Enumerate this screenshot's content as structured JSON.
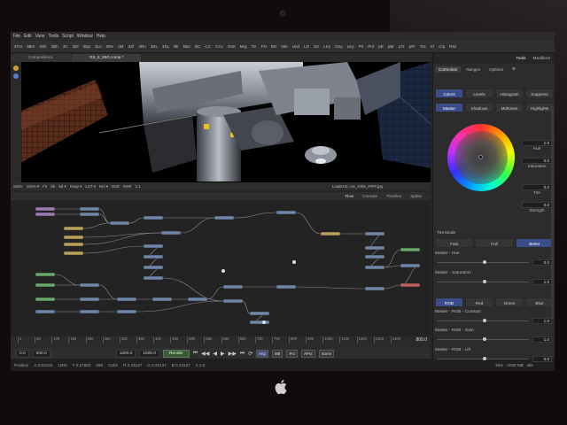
{
  "menus": [
    "File",
    "Edit",
    "View",
    "Tools",
    "Script",
    "Window",
    "Help"
  ],
  "toolbar_tools": [
    "3Txt",
    "3Bm",
    "3Sh",
    "3Bh",
    "3C",
    "3Dl",
    "3Dp",
    "3Lo",
    "3Re",
    "3M",
    "3Xf",
    "3Rn",
    "3SL",
    "3SL",
    "Blr",
    "Blur",
    "BC",
    "CC",
    "CCv",
    "Gmt",
    "Mrg",
    "Tcr",
    "FN",
    "BG",
    "Nte",
    "Und",
    "LD",
    "SV",
    "LKy",
    "CKy",
    "LKy",
    "Pri",
    "Pnt",
    "pE",
    "pBr",
    "pTr",
    "pPr",
    "Tra",
    "Xf",
    "Crp",
    "Rsz"
  ],
  "tabs": [
    "Composition1",
    "RS_5_95G.comp *"
  ],
  "viewer_bar": [
    "SubV",
    "116% ▾",
    "Fit",
    "Sb",
    "6d ▾",
    "Snap ▾",
    "LUT ▾",
    "Roi ▾",
    "DoD",
    "SmR",
    "1:1"
  ],
  "loader_label": "Loader11: iss_v006_####.jpg",
  "flow_tabs": [
    "Flow",
    "Console",
    "Timeline",
    "Spline"
  ],
  "ruler_ticks": [
    "0",
    "50",
    "100",
    "150",
    "200",
    "250",
    "300",
    "350",
    "400",
    "450",
    "500",
    "550",
    "600",
    "650",
    "700",
    "750",
    "800",
    "900",
    "1000",
    "1100",
    "1200",
    "1300",
    "1400"
  ],
  "time_end": "800.0",
  "transport": {
    "start": "0.0",
    "range_start": "800.0",
    "mid_a": "1200.0",
    "mid_b": "1500.0",
    "render": "Render",
    "buttons": [
      "HiQ",
      "MB",
      "Prx",
      "APrx",
      "Some"
    ]
  },
  "status": {
    "position_label": "Position",
    "x": "X 0.52102",
    "frame": "1000",
    "y": "Y 0.27583",
    "val": "298",
    "color_label": "Color",
    "r": "R 0.23137",
    "g": "G 0.23137",
    "b": "B 0.23137",
    "a": "A 1.0",
    "right": "25% - 2008 MB",
    "state": "Idle"
  },
  "panel": {
    "tabs": [
      "Tools",
      "Modifiers"
    ],
    "ctabs": [
      "Correction",
      "Ranges",
      "Options"
    ],
    "row1": [
      "Colors",
      "Levels",
      "Histogram",
      "Suppress"
    ],
    "row2": [
      "Master",
      "Shadows",
      "Midtones",
      "Highlights"
    ],
    "hue_label": "Hue",
    "hue_val": "1.0",
    "sat_label": "Saturation",
    "sat_val": "0.0",
    "tint_label": "Tint",
    "tint_val": "0.0",
    "strength_label": "Strength",
    "strength_val": "0.0",
    "tint_mode_label": "Tint Mode",
    "tint_mode": [
      "Fast",
      "Full",
      "Better"
    ],
    "sliders_a": [
      {
        "label": "Master - Hue",
        "value": "0.0"
      },
      {
        "label": "Master - Saturation",
        "value": "1.0"
      }
    ],
    "channels": [
      "RGB",
      "Red",
      "Green",
      "Blue"
    ],
    "sliders_b": [
      {
        "label": "Master - RGB - Contrast",
        "value": "1.0"
      },
      {
        "label": "Master - RGB - Gain",
        "value": "1.0"
      },
      {
        "label": "Master - RGB - Lift",
        "value": "0.0"
      },
      {
        "label": "Master - RGB - Gamma",
        "value": "1.0"
      }
    ]
  },
  "colors": {
    "accent": "#3a4c8a",
    "node_blue": "#6f86a8",
    "node_yellow": "#b9a05a",
    "node_green": "#6aa86a",
    "node_red": "#c06060",
    "node_purple": "#9a7ab0"
  }
}
